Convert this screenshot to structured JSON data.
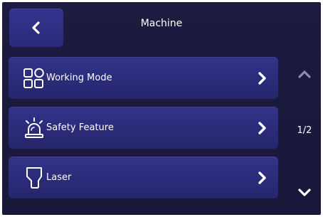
{
  "header": {
    "title": "Machine",
    "back_icon": "chevron-left-icon"
  },
  "menu": {
    "items": [
      {
        "label": "Working Mode",
        "icon": "grid-icon"
      },
      {
        "label": "Safety Feature",
        "icon": "alarm-light-icon"
      },
      {
        "label": "Laser",
        "icon": "laser-head-icon"
      }
    ]
  },
  "pagination": {
    "indicator": "1/2",
    "up_icon": "chevron-up-icon",
    "down_icon": "chevron-down-icon"
  },
  "colors": {
    "background": "#1c1b40",
    "button": "#2b2b7a",
    "text": "#ffffff",
    "scroll_up_disabled": "#8b8aa8"
  }
}
